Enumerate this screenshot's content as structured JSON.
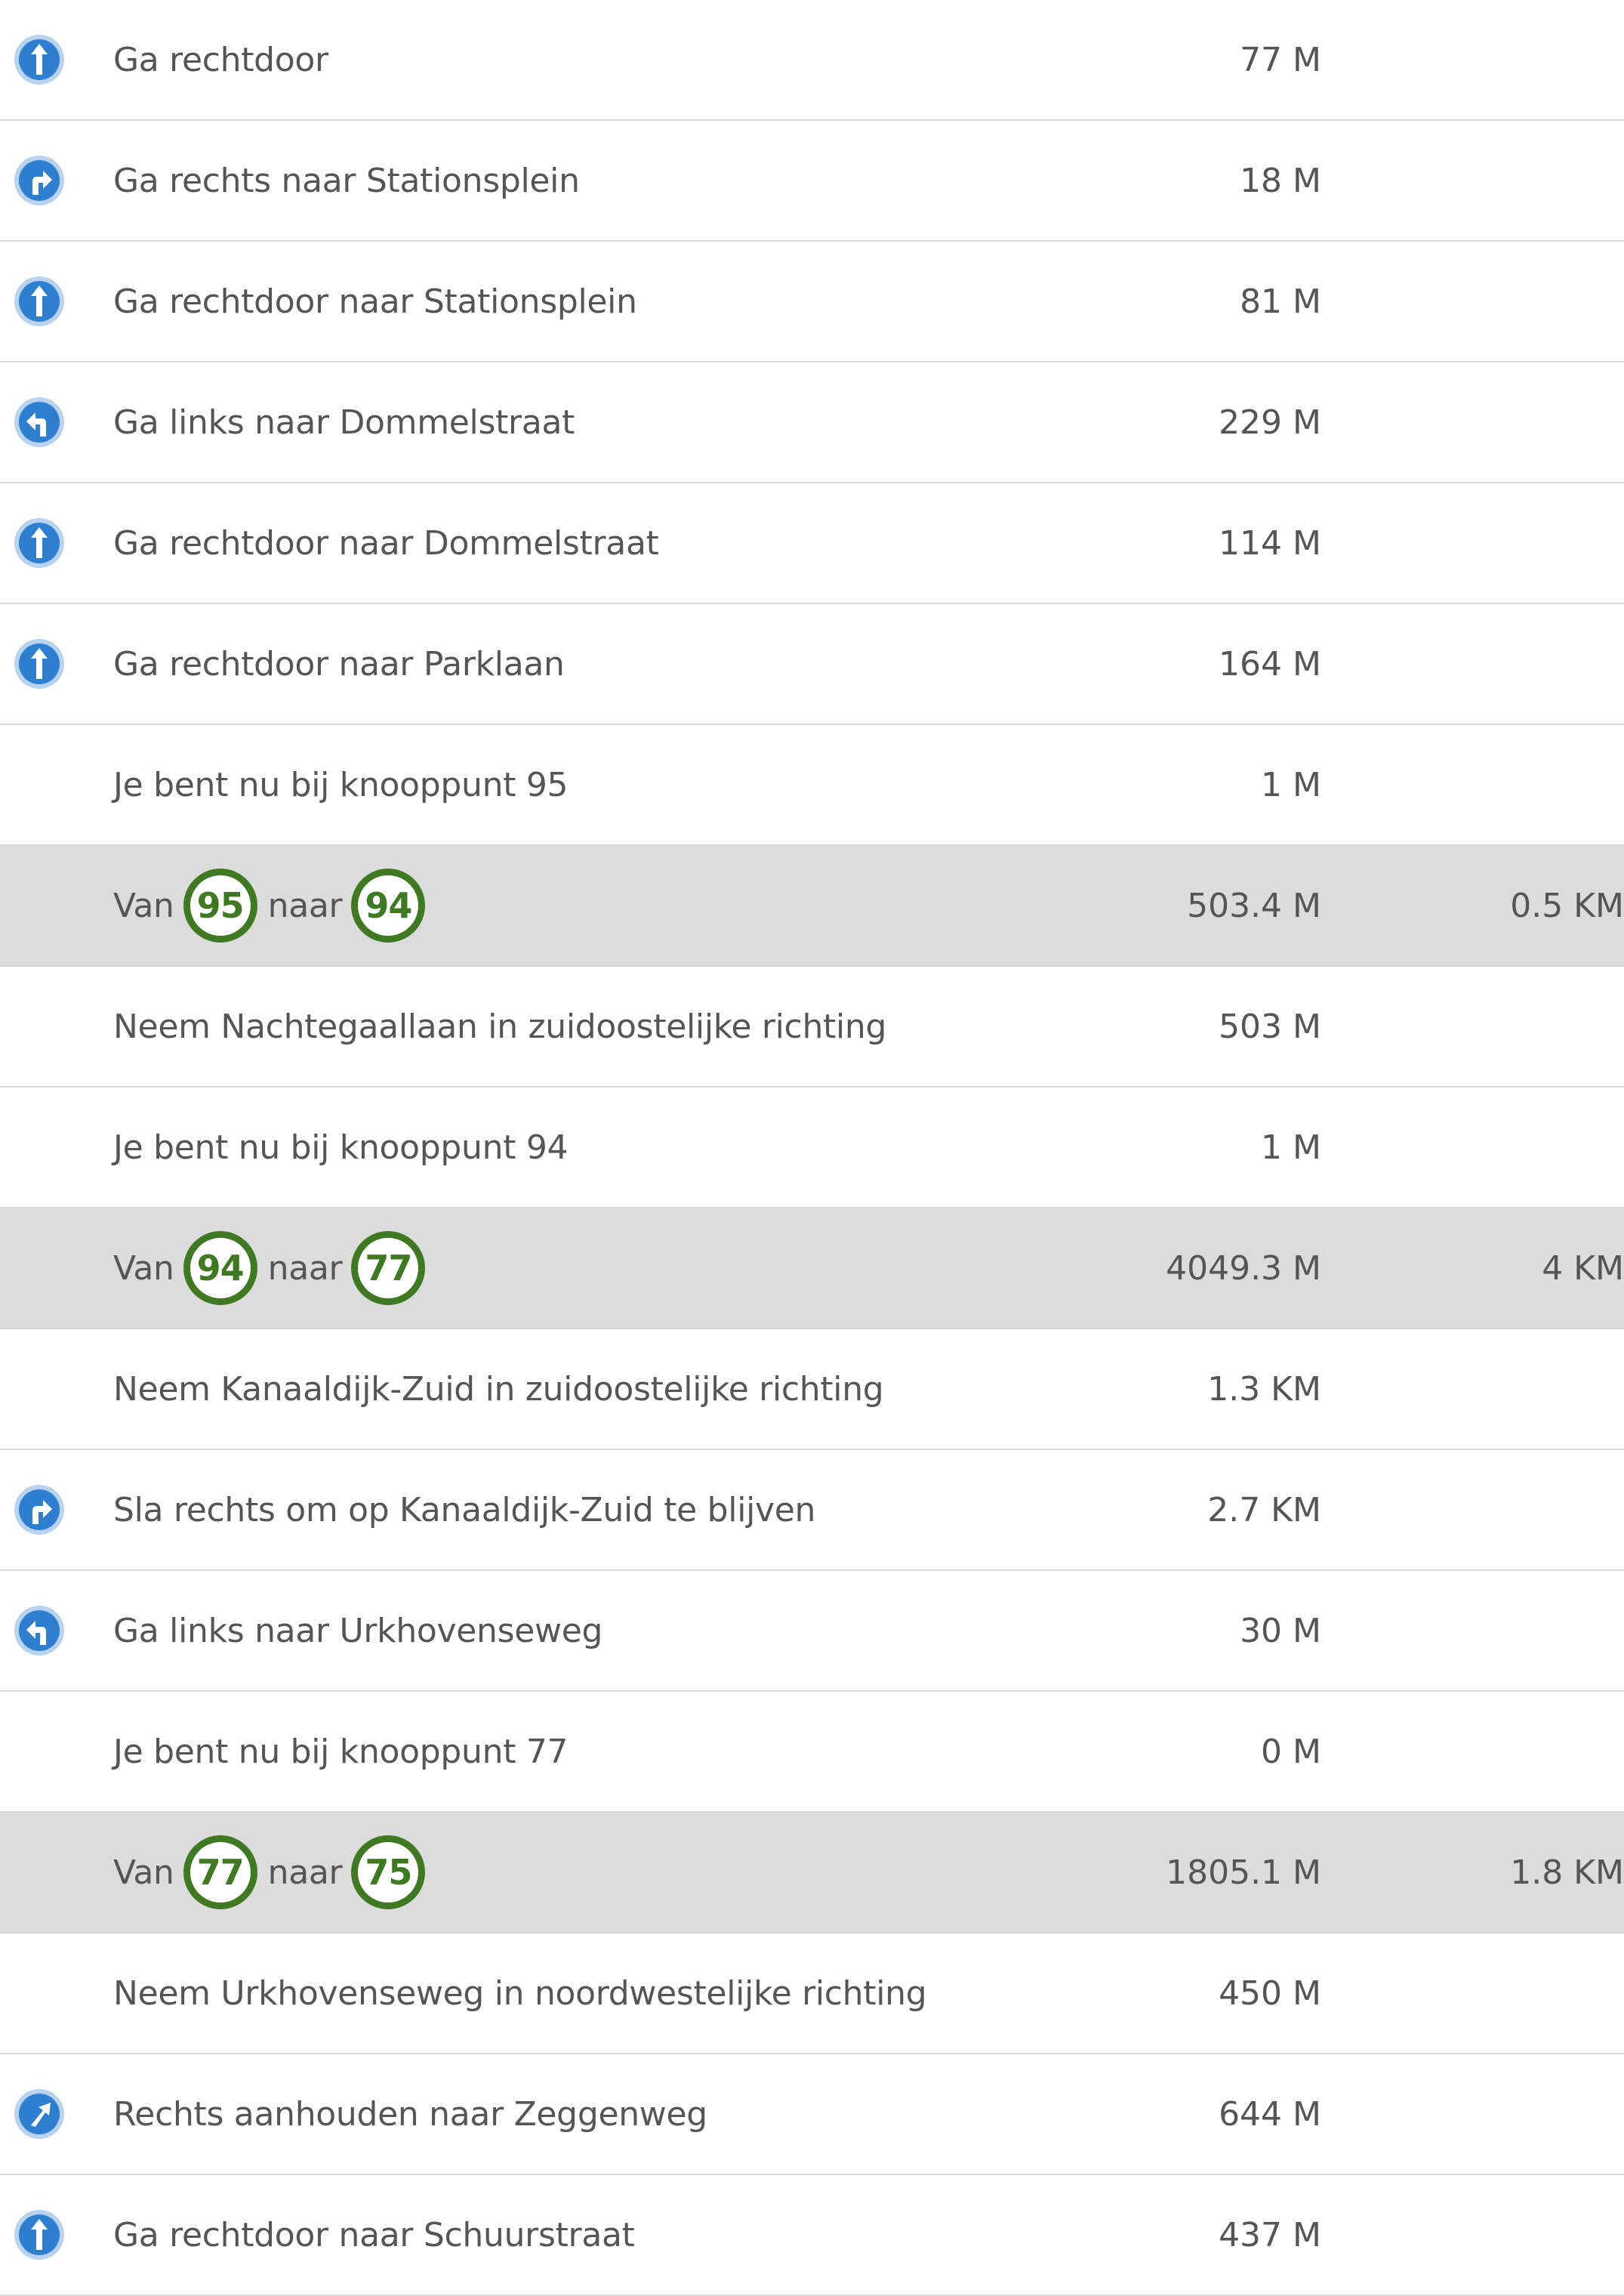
{
  "colors": {
    "icon_blue": "#2f7fd0",
    "icon_ring": "#b9d3ef",
    "node_green": "#3f7a22",
    "segment_bg": "#dcdcdc",
    "text": "#555555"
  },
  "segment_words": {
    "from": "Van",
    "to": "naar"
  },
  "rows": [
    {
      "type": "step",
      "icon": "straight-arrow-icon",
      "text": "Ga rechtdoor",
      "distance": "77 M"
    },
    {
      "type": "step",
      "icon": "turn-right-arrow-icon",
      "text": "Ga rechts naar Stationsplein",
      "distance": "18 M"
    },
    {
      "type": "step",
      "icon": "straight-arrow-icon",
      "text": "Ga rechtdoor naar Stationsplein",
      "distance": "81 M"
    },
    {
      "type": "step",
      "icon": "turn-left-arrow-icon",
      "text": "Ga links naar Dommelstraat",
      "distance": "229 M"
    },
    {
      "type": "step",
      "icon": "straight-arrow-icon",
      "text": "Ga rechtdoor naar Dommelstraat",
      "distance": "114 M"
    },
    {
      "type": "step",
      "icon": "straight-arrow-icon",
      "text": "Ga rechtdoor naar Parklaan",
      "distance": "164 M"
    },
    {
      "type": "step",
      "icon": "",
      "text": "Je bent nu bij knooppunt 95",
      "distance": "1 M"
    },
    {
      "type": "segment",
      "from_node": "95",
      "to_node": "94",
      "distance": "503.4 M",
      "total": "0.5 KM"
    },
    {
      "type": "step",
      "icon": "",
      "text": "Neem Nachtegaallaan in zuidoostelijke richting",
      "distance": "503 M"
    },
    {
      "type": "step",
      "icon": "",
      "text": "Je bent nu bij knooppunt 94",
      "distance": "1 M"
    },
    {
      "type": "segment",
      "from_node": "94",
      "to_node": "77",
      "distance": "4049.3 M",
      "total": "4 KM"
    },
    {
      "type": "step",
      "icon": "",
      "text": "Neem Kanaaldijk-Zuid in zuidoostelijke richting",
      "distance": "1.3 KM"
    },
    {
      "type": "step",
      "icon": "turn-right-arrow-icon",
      "text": "Sla rechts om op Kanaaldijk-Zuid te blijven",
      "distance": "2.7 KM"
    },
    {
      "type": "step",
      "icon": "turn-left-arrow-icon",
      "text": "Ga links naar Urkhovenseweg",
      "distance": "30 M"
    },
    {
      "type": "step",
      "icon": "",
      "text": "Je bent nu bij knooppunt 77",
      "distance": "0 M"
    },
    {
      "type": "segment",
      "from_node": "77",
      "to_node": "75",
      "distance": "1805.1 M",
      "total": "1.8 KM"
    },
    {
      "type": "step",
      "icon": "",
      "text": "Neem Urkhovenseweg in noordwestelijke richting",
      "distance": "450 M"
    },
    {
      "type": "step",
      "icon": "keep-right-arrow-icon",
      "text": "Rechts aanhouden naar Zeggenweg",
      "distance": "644 M"
    },
    {
      "type": "step",
      "icon": "straight-arrow-icon",
      "text": "Ga rechtdoor naar Schuurstraat",
      "distance": "437 M"
    }
  ]
}
